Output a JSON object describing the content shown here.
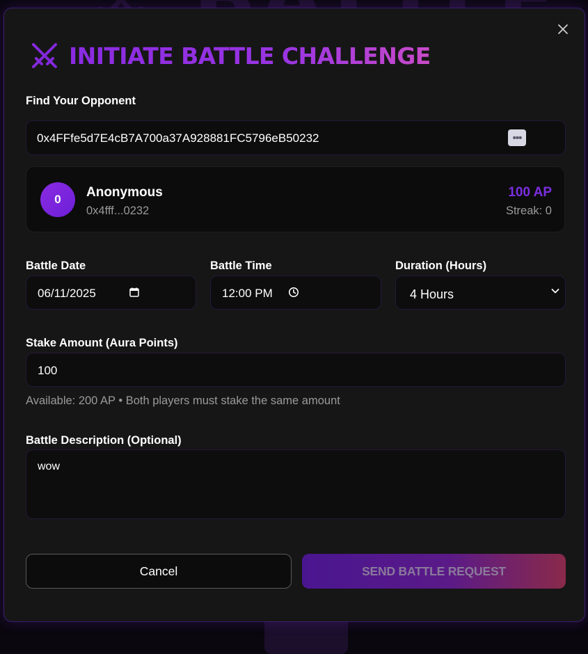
{
  "modal": {
    "title": "INITIATE BATTLE CHALLENGE",
    "title_icon": "crossed-swords-icon",
    "close_icon": "close-icon"
  },
  "opponent": {
    "label": "Find Your Opponent",
    "address": "0x4FFfe5d7E4cB7A700a37A928881FC5796eB50232",
    "wallet_icon": "wallet-icon",
    "card": {
      "avatar_initial": "0",
      "name": "Anonymous",
      "short_address": "0x4fff...0232",
      "points": "100 AP",
      "streak": "Streak: 0"
    }
  },
  "schedule": {
    "date_label": "Battle Date",
    "date_value": "06/11/2025",
    "time_label": "Battle Time",
    "time_value": "12:00 PM",
    "duration_label": "Duration (Hours)",
    "duration_value": "4 Hours"
  },
  "stake": {
    "label": "Stake Amount (Aura Points)",
    "value": "100",
    "hint": "Available: 200 AP • Both players must stake the same amount"
  },
  "description": {
    "label": "Battle Description (Optional)",
    "value": "wow"
  },
  "actions": {
    "cancel_label": "Cancel",
    "send_label": "SEND BATTLE REQUEST"
  },
  "colors": {
    "accent": "#8a2be2",
    "accent_pink": "#c94bc8",
    "modal_bg": "#161616",
    "field_bg": "#0d0d0d"
  }
}
